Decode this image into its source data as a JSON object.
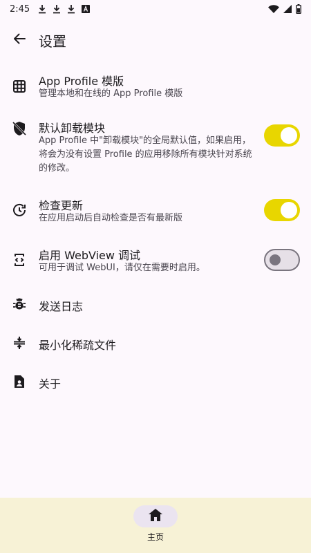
{
  "status_bar": {
    "time": "2:45",
    "notification_icons": [
      "download-icon",
      "download-icon",
      "download-icon",
      "app-icon"
    ],
    "system_icons": [
      "wifi-icon",
      "signal-icon",
      "battery-icon"
    ]
  },
  "header": {
    "title": "设置"
  },
  "settings": {
    "items": [
      {
        "icon": "grid-icon",
        "title": "App Profile 模版",
        "description": "管理本地和在线的 App Profile 模版"
      },
      {
        "icon": "shield-off-icon",
        "title": "默认卸载模块",
        "description": "App Profile 中\"卸载模块\"的全局默认值，如果启用，将会为没有设置 Profile 的应用移除所有模块针对系统的修改。",
        "switch_on": true
      },
      {
        "icon": "update-icon",
        "title": "检查更新",
        "description": "在应用启动后自动检查是否有最新版",
        "switch_on": true
      },
      {
        "icon": "webview-icon",
        "title": "启用 WebView 调试",
        "description": "可用于调试 WebUI，请仅在需要时启用。",
        "switch_on": false
      },
      {
        "icon": "bug-icon",
        "title": "发送日志"
      },
      {
        "icon": "compress-icon",
        "title": "最小化稀疏文件"
      },
      {
        "icon": "contact-icon",
        "title": "关于"
      }
    ]
  },
  "bottom_nav": {
    "items": [
      {
        "icon": "home-icon",
        "label": "主页"
      }
    ]
  },
  "colors": {
    "background": "#fdf8fd",
    "switch_on": "#e8d600",
    "bottom_nav": "#f7f2d6",
    "nav_indicator": "#ebe4f0"
  }
}
